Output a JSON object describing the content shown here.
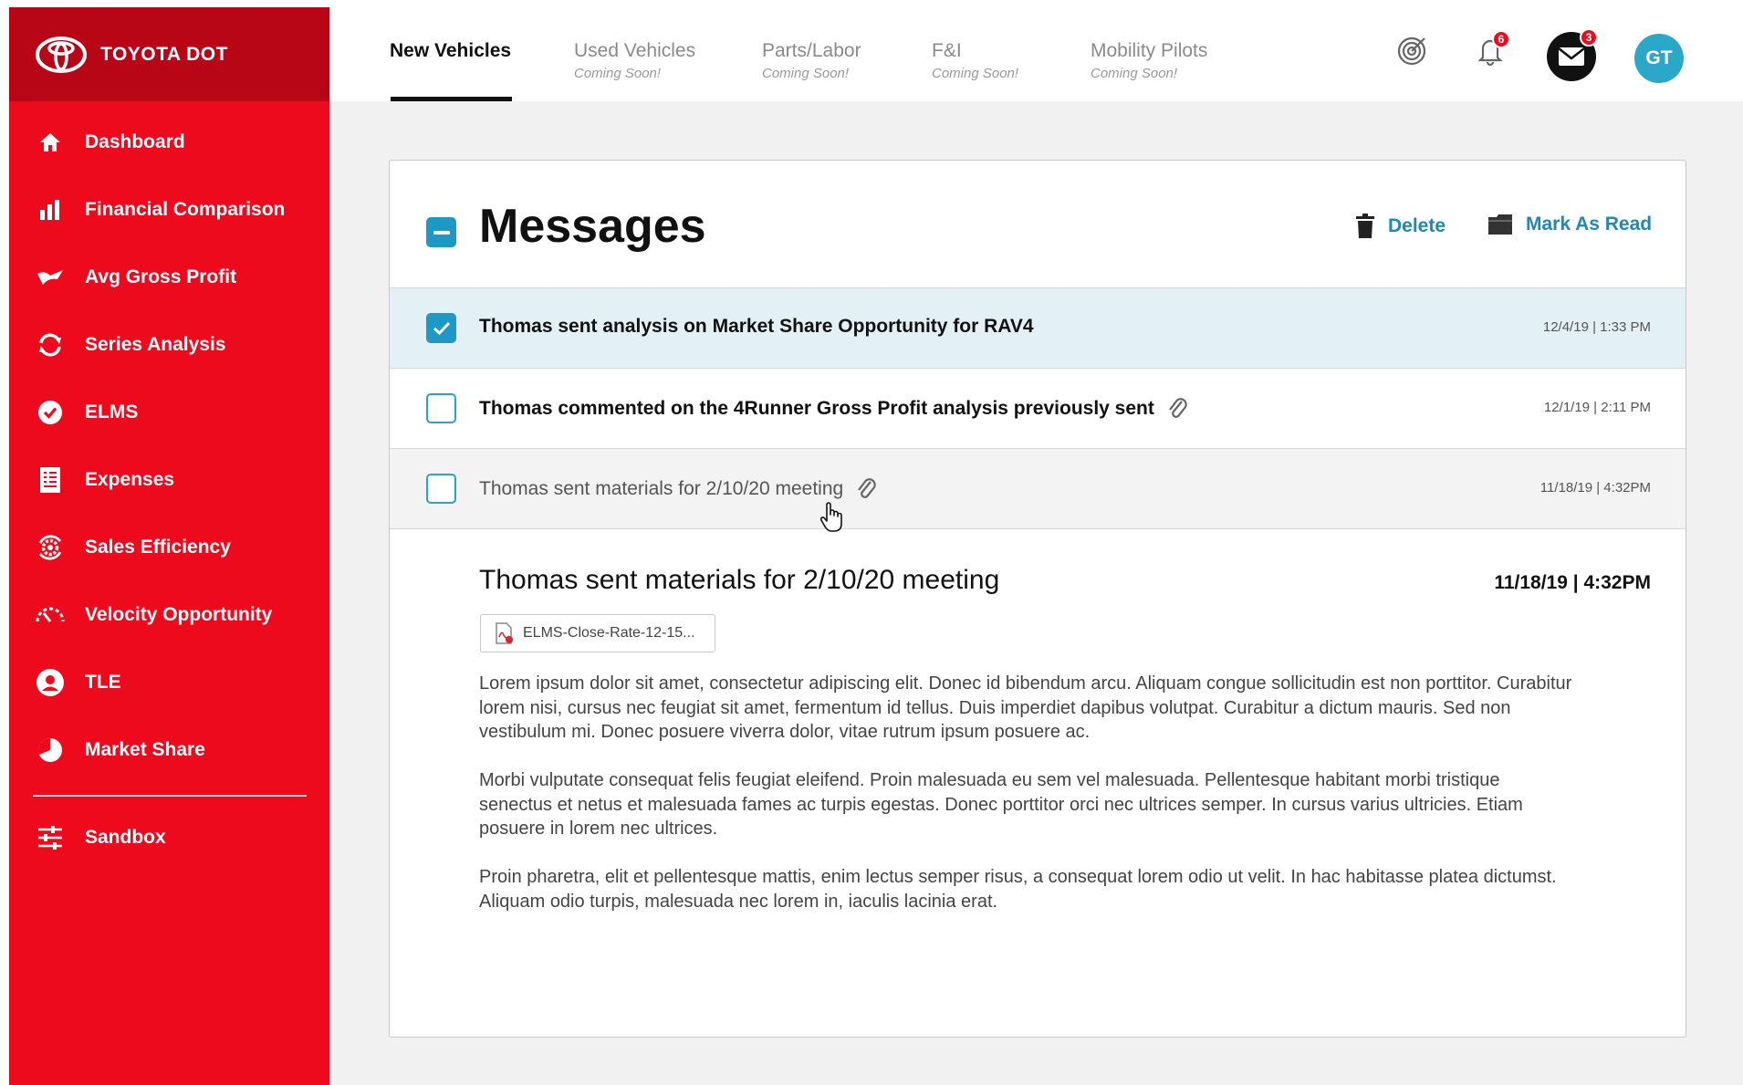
{
  "brand": {
    "name": "TOYOTA DOT",
    "logo_icon": "toyota-logo"
  },
  "sidebar": {
    "items": [
      {
        "label": "Dashboard",
        "icon": "home-icon"
      },
      {
        "label": "Financial Comparison",
        "icon": "bar-chart-icon"
      },
      {
        "label": "Avg Gross Profit",
        "icon": "gross-profit-icon"
      },
      {
        "label": "Series Analysis",
        "icon": "refresh-icon"
      },
      {
        "label": "ELMS",
        "icon": "check-circle-icon"
      },
      {
        "label": "Expenses",
        "icon": "receipt-icon"
      },
      {
        "label": "Sales Efficiency",
        "icon": "gear-cycle-icon"
      },
      {
        "label": "Velocity Opportunity",
        "icon": "speedometer-icon"
      },
      {
        "label": "TLE",
        "icon": "user-circle-icon"
      },
      {
        "label": "Market Share",
        "icon": "pie-chart-icon"
      }
    ],
    "sandbox": {
      "label": "Sandbox",
      "icon": "sliders-icon"
    }
  },
  "tabs": [
    {
      "label": "New Vehicles",
      "sub": "",
      "active": true
    },
    {
      "label": "Used Vehicles",
      "sub": "Coming Soon!"
    },
    {
      "label": "Parts/Labor",
      "sub": "Coming Soon!"
    },
    {
      "label": "F&I",
      "sub": "Coming Soon!"
    },
    {
      "label": "Mobility Pilots",
      "sub": "Coming Soon!"
    }
  ],
  "header_icons": {
    "target": "target-icon",
    "notifications": {
      "icon": "bell-icon",
      "count": "6"
    },
    "mail": {
      "icon": "mail-icon",
      "count": "3"
    },
    "avatar_initials": "GT"
  },
  "messages": {
    "title": "Messages",
    "delete_label": "Delete",
    "mark_read_label": "Mark As Read",
    "list": [
      {
        "text": "Thomas sent analysis on Market Share Opportunity for RAV4",
        "date": "12/4/19  |  1:33 PM",
        "checked": true,
        "bold": true,
        "attachment": false
      },
      {
        "text": "Thomas commented on the 4Runner Gross Profit analysis previously sent",
        "date": "12/1/19  |  2:11 PM",
        "checked": false,
        "bold": true,
        "attachment": true
      },
      {
        "text": "Thomas sent materials for 2/10/20 meeting",
        "date": "11/18/19  |  4:32PM",
        "checked": false,
        "bold": false,
        "attachment": true
      }
    ],
    "detail": {
      "title": "Thomas sent materials for 2/10/20 meeting",
      "date": "11/18/19  |  4:32PM",
      "attachment_name": "ELMS-Close-Rate-12-15...",
      "paragraphs": [
        "Lorem ipsum dolor sit amet, consectetur adipiscing elit. Donec id bibendum arcu. Aliquam congue sollicitudin est non porttitor. Curabitur lorem nisi, cursus nec feugiat sit amet, fermentum id tellus. Duis imperdiet dapibus volutpat. Curabitur a dictum mauris. Sed non vestibulum mi. Donec posuere viverra dolor, vitae rutrum ipsum posuere ac.",
        "Morbi vulputate consequat felis feugiat eleifend. Proin malesuada eu sem vel malesuada. Pellentesque habitant morbi tristique senectus et netus et malesuada fames ac turpis egestas. Donec porttitor orci nec ultrices semper. In cursus varius ultricies. Etiam posuere in lorem nec ultrices.",
        "Proin pharetra, elit et pellentesque mattis, enim lectus semper risus, a consequat lorem odio ut velit. In hac habitasse platea dictumst. Aliquam odio turpis, malesuada nec lorem in, iaculis lacinia erat."
      ]
    }
  },
  "colors": {
    "brand_red": "#ec0a1c",
    "brand_dark_red": "#b80617",
    "accent_blue": "#1e98c4",
    "selected_row": "#e3f1f6"
  }
}
